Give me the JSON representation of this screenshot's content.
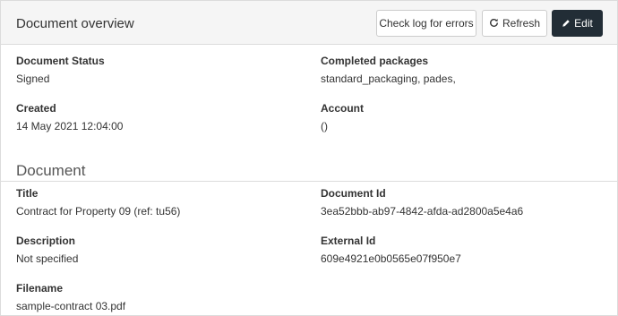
{
  "header": {
    "title": "Document overview",
    "buttons": {
      "check_log": "Check log for errors",
      "refresh": "Refresh",
      "edit": "Edit"
    }
  },
  "overview": {
    "document_status": {
      "label": "Document Status",
      "value": "Signed"
    },
    "completed_packages": {
      "label": "Completed packages",
      "value": "standard_packaging, pades,"
    },
    "created": {
      "label": "Created",
      "value": "14 May 2021 12:04:00"
    },
    "account": {
      "label": "Account",
      "value": "()"
    }
  },
  "document": {
    "heading": "Document",
    "title": {
      "label": "Title",
      "value": "Contract for Property 09 (ref: tu56)"
    },
    "document_id": {
      "label": "Document Id",
      "value": "3ea52bbb-ab97-4842-afda-ad2800a5e4a6"
    },
    "description": {
      "label": "Description",
      "value": "Not specified"
    },
    "external_id": {
      "label": "External Id",
      "value": "609e4921e0b0565e07f950e7"
    },
    "filename": {
      "label": "Filename",
      "value": "sample-contract 03.pdf"
    }
  },
  "icons": {
    "refresh": "refresh-icon",
    "edit": "pencil-icon"
  },
  "colors": {
    "edit_button_bg": "#222d36",
    "header_bg": "#f5f5f5",
    "border": "#dcdcdc"
  }
}
